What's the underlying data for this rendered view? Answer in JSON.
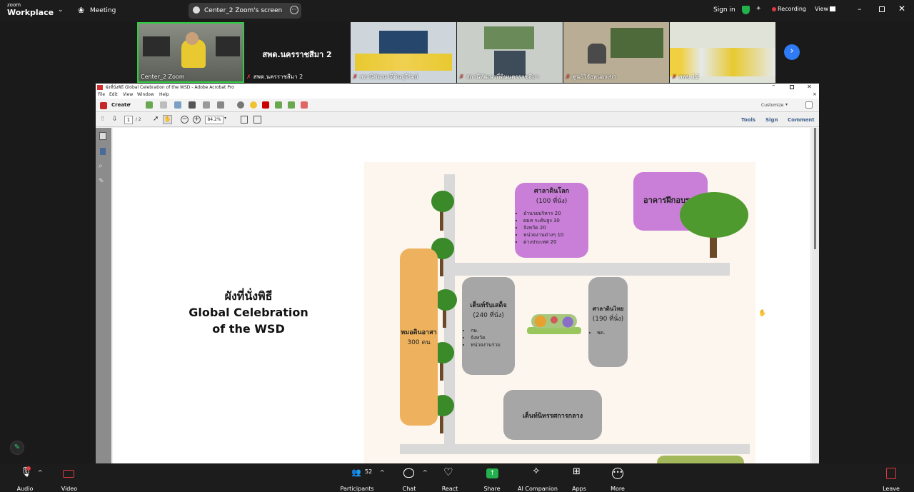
{
  "zoom": {
    "logo_line1": "zoom",
    "logo_line2": "Workplace",
    "meeting_label": "Meeting",
    "share_label": "Center_2 Zoom's screen",
    "sign_in": "Sign in",
    "recording": "Recording",
    "view": "View"
  },
  "gallery": {
    "tiles": [
      {
        "name": "Center_2 Zoom"
      },
      {
        "name": "สพด.นครราชสีมา 2",
        "big": "สพด.นครราชสีมา 2"
      },
      {
        "name": "สถานีพัฒนาที่ดินบุรีรัมย์"
      },
      {
        "name": "สถานีพัฒนาที่ดินนครราชสีมา"
      },
      {
        "name": "ศูนย์วิจัยหนองเขา"
      },
      {
        "name": "สพข.12"
      }
    ]
  },
  "acrobat": {
    "title": "ผังที่นั่งพิธี Global Celebration of the WSD - Adobe Acrobat Pro",
    "menu": [
      "File",
      "Edit",
      "View",
      "Window",
      "Help"
    ],
    "create": "Create",
    "customize": "Customize",
    "page_current": "1",
    "page_total": "/ 2",
    "zoom": "84.2%",
    "tools": "Tools",
    "sign": "Sign",
    "comment": "Comment"
  },
  "slide": {
    "title1": "ผังที่นั่งพิธี",
    "title2": "Global Celebration",
    "title3": "of the WSD",
    "sala_world": {
      "title": "ศาลาดินโลก",
      "count": "(100 ที่นั่ง)",
      "items": [
        "อำนวยบริหาร 20",
        "ผมห ระดับสูง 30",
        "จังหวัด 20",
        "หน่วยงานต่างๆ 10",
        "ต่างประเทศ 20"
      ]
    },
    "training": "อาคารฝึกอบรม",
    "tent_guest": {
      "title": "เต็นท์รับเสด็จ",
      "count": "(240 ที่นั่ง)",
      "items": [
        "กษ.",
        "จังหวัด",
        "หน่วยงานร่วม"
      ]
    },
    "sala_thai": {
      "title": "ศาลาดินไทย",
      "count": "(190 ที่นั่ง)",
      "items": [
        "พด."
      ]
    },
    "mor_din": {
      "title": "หมอดินอาสา",
      "count": "300 คน"
    },
    "tent_exhibit": "เต็นท์นิทรรศการกลาง"
  },
  "bottom": {
    "audio": "Audio",
    "video": "Video",
    "participants": "Participants",
    "participants_count": "52",
    "chat": "Chat",
    "react": "React",
    "share": "Share",
    "ai": "AI Companion",
    "apps": "Apps",
    "more": "More",
    "leave": "Leave"
  }
}
